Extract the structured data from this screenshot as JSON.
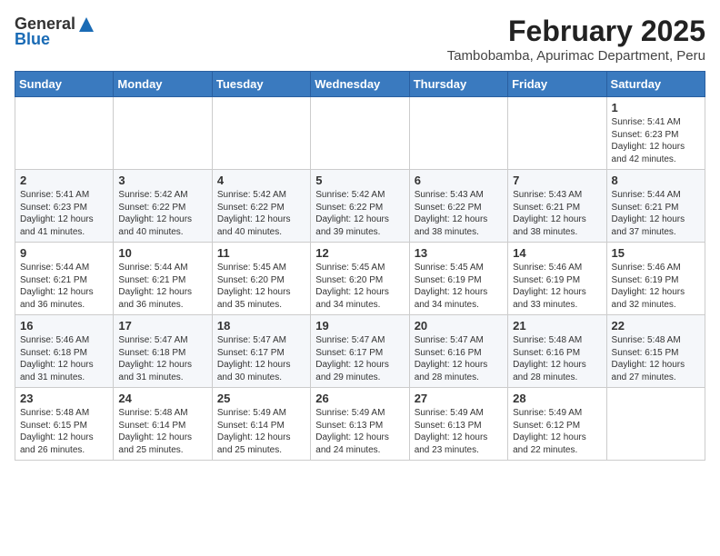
{
  "header": {
    "logo_general": "General",
    "logo_blue": "Blue",
    "month_title": "February 2025",
    "subtitle": "Tambobamba, Apurimac Department, Peru"
  },
  "days_of_week": [
    "Sunday",
    "Monday",
    "Tuesday",
    "Wednesday",
    "Thursday",
    "Friday",
    "Saturday"
  ],
  "weeks": [
    {
      "days": [
        {
          "num": "",
          "text": ""
        },
        {
          "num": "",
          "text": ""
        },
        {
          "num": "",
          "text": ""
        },
        {
          "num": "",
          "text": ""
        },
        {
          "num": "",
          "text": ""
        },
        {
          "num": "",
          "text": ""
        },
        {
          "num": "1",
          "text": "Sunrise: 5:41 AM\nSunset: 6:23 PM\nDaylight: 12 hours and 42 minutes."
        }
      ]
    },
    {
      "days": [
        {
          "num": "2",
          "text": "Sunrise: 5:41 AM\nSunset: 6:23 PM\nDaylight: 12 hours and 41 minutes."
        },
        {
          "num": "3",
          "text": "Sunrise: 5:42 AM\nSunset: 6:22 PM\nDaylight: 12 hours and 40 minutes."
        },
        {
          "num": "4",
          "text": "Sunrise: 5:42 AM\nSunset: 6:22 PM\nDaylight: 12 hours and 40 minutes."
        },
        {
          "num": "5",
          "text": "Sunrise: 5:42 AM\nSunset: 6:22 PM\nDaylight: 12 hours and 39 minutes."
        },
        {
          "num": "6",
          "text": "Sunrise: 5:43 AM\nSunset: 6:22 PM\nDaylight: 12 hours and 38 minutes."
        },
        {
          "num": "7",
          "text": "Sunrise: 5:43 AM\nSunset: 6:21 PM\nDaylight: 12 hours and 38 minutes."
        },
        {
          "num": "8",
          "text": "Sunrise: 5:44 AM\nSunset: 6:21 PM\nDaylight: 12 hours and 37 minutes."
        }
      ]
    },
    {
      "days": [
        {
          "num": "9",
          "text": "Sunrise: 5:44 AM\nSunset: 6:21 PM\nDaylight: 12 hours and 36 minutes."
        },
        {
          "num": "10",
          "text": "Sunrise: 5:44 AM\nSunset: 6:21 PM\nDaylight: 12 hours and 36 minutes."
        },
        {
          "num": "11",
          "text": "Sunrise: 5:45 AM\nSunset: 6:20 PM\nDaylight: 12 hours and 35 minutes."
        },
        {
          "num": "12",
          "text": "Sunrise: 5:45 AM\nSunset: 6:20 PM\nDaylight: 12 hours and 34 minutes."
        },
        {
          "num": "13",
          "text": "Sunrise: 5:45 AM\nSunset: 6:19 PM\nDaylight: 12 hours and 34 minutes."
        },
        {
          "num": "14",
          "text": "Sunrise: 5:46 AM\nSunset: 6:19 PM\nDaylight: 12 hours and 33 minutes."
        },
        {
          "num": "15",
          "text": "Sunrise: 5:46 AM\nSunset: 6:19 PM\nDaylight: 12 hours and 32 minutes."
        }
      ]
    },
    {
      "days": [
        {
          "num": "16",
          "text": "Sunrise: 5:46 AM\nSunset: 6:18 PM\nDaylight: 12 hours and 31 minutes."
        },
        {
          "num": "17",
          "text": "Sunrise: 5:47 AM\nSunset: 6:18 PM\nDaylight: 12 hours and 31 minutes."
        },
        {
          "num": "18",
          "text": "Sunrise: 5:47 AM\nSunset: 6:17 PM\nDaylight: 12 hours and 30 minutes."
        },
        {
          "num": "19",
          "text": "Sunrise: 5:47 AM\nSunset: 6:17 PM\nDaylight: 12 hours and 29 minutes."
        },
        {
          "num": "20",
          "text": "Sunrise: 5:47 AM\nSunset: 6:16 PM\nDaylight: 12 hours and 28 minutes."
        },
        {
          "num": "21",
          "text": "Sunrise: 5:48 AM\nSunset: 6:16 PM\nDaylight: 12 hours and 28 minutes."
        },
        {
          "num": "22",
          "text": "Sunrise: 5:48 AM\nSunset: 6:15 PM\nDaylight: 12 hours and 27 minutes."
        }
      ]
    },
    {
      "days": [
        {
          "num": "23",
          "text": "Sunrise: 5:48 AM\nSunset: 6:15 PM\nDaylight: 12 hours and 26 minutes."
        },
        {
          "num": "24",
          "text": "Sunrise: 5:48 AM\nSunset: 6:14 PM\nDaylight: 12 hours and 25 minutes."
        },
        {
          "num": "25",
          "text": "Sunrise: 5:49 AM\nSunset: 6:14 PM\nDaylight: 12 hours and 25 minutes."
        },
        {
          "num": "26",
          "text": "Sunrise: 5:49 AM\nSunset: 6:13 PM\nDaylight: 12 hours and 24 minutes."
        },
        {
          "num": "27",
          "text": "Sunrise: 5:49 AM\nSunset: 6:13 PM\nDaylight: 12 hours and 23 minutes."
        },
        {
          "num": "28",
          "text": "Sunrise: 5:49 AM\nSunset: 6:12 PM\nDaylight: 12 hours and 22 minutes."
        },
        {
          "num": "",
          "text": ""
        }
      ]
    }
  ]
}
